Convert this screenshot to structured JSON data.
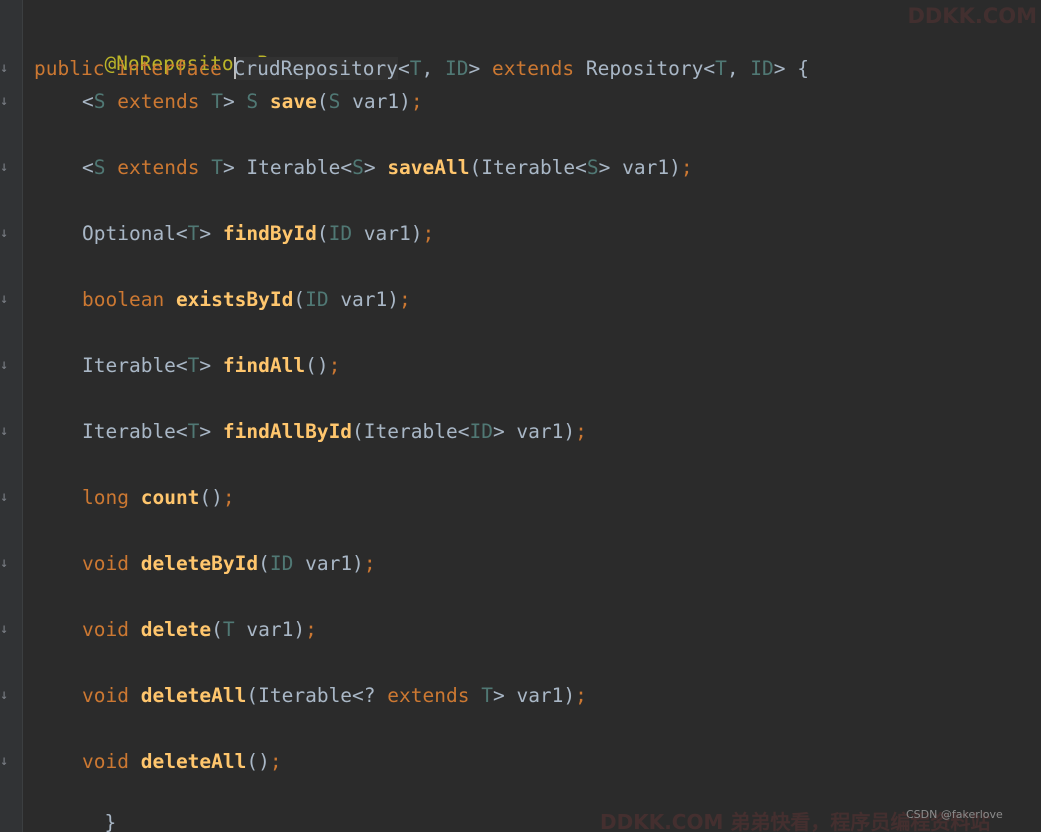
{
  "editor": {
    "code": {
      "annotation": "@NoRepositoryBean",
      "decl": {
        "public": "public",
        "interface": "interface",
        "name_first": "C",
        "name_rest": "rudRepository",
        "lt1": "<",
        "T": "T",
        "comma": ", ",
        "ID": "ID",
        "gt1": ">",
        "extends": "extends",
        "parent": "Repository",
        "lt2": "<",
        "T2": "T",
        "comma2": ", ",
        "ID2": "ID",
        "gt2": ">",
        "brace": "{"
      },
      "methods": [
        [
          {
            "t": "pl",
            "v": "<"
          },
          {
            "t": "tp",
            "v": "S"
          },
          {
            "t": "pl",
            "v": " "
          },
          {
            "t": "kw",
            "v": "extends"
          },
          {
            "t": "pl",
            "v": " "
          },
          {
            "t": "tp",
            "v": "T"
          },
          {
            "t": "pl",
            "v": "> "
          },
          {
            "t": "tp",
            "v": "S"
          },
          {
            "t": "pl",
            "v": " "
          },
          {
            "t": "fn",
            "v": "save"
          },
          {
            "t": "pl",
            "v": "("
          },
          {
            "t": "tp",
            "v": "S"
          },
          {
            "t": "pl",
            "v": " var1)"
          },
          {
            "t": "kw",
            "v": ";"
          }
        ],
        [
          {
            "t": "pl",
            "v": "<"
          },
          {
            "t": "tp",
            "v": "S"
          },
          {
            "t": "pl",
            "v": " "
          },
          {
            "t": "kw",
            "v": "extends"
          },
          {
            "t": "pl",
            "v": " "
          },
          {
            "t": "tp",
            "v": "T"
          },
          {
            "t": "pl",
            "v": "> Iterable<"
          },
          {
            "t": "tp",
            "v": "S"
          },
          {
            "t": "pl",
            "v": "> "
          },
          {
            "t": "fn",
            "v": "saveAll"
          },
          {
            "t": "pl",
            "v": "(Iterable<"
          },
          {
            "t": "tp",
            "v": "S"
          },
          {
            "t": "pl",
            "v": "> var1)"
          },
          {
            "t": "kw",
            "v": ";"
          }
        ],
        [
          {
            "t": "pl",
            "v": "Optional<"
          },
          {
            "t": "tp",
            "v": "T"
          },
          {
            "t": "pl",
            "v": "> "
          },
          {
            "t": "fn",
            "v": "findById"
          },
          {
            "t": "pl",
            "v": "("
          },
          {
            "t": "tp",
            "v": "ID"
          },
          {
            "t": "pl",
            "v": " var1)"
          },
          {
            "t": "kw",
            "v": ";"
          }
        ],
        [
          {
            "t": "kw",
            "v": "boolean"
          },
          {
            "t": "pl",
            "v": " "
          },
          {
            "t": "fn",
            "v": "existsById"
          },
          {
            "t": "pl",
            "v": "("
          },
          {
            "t": "tp",
            "v": "ID"
          },
          {
            "t": "pl",
            "v": " var1)"
          },
          {
            "t": "kw",
            "v": ";"
          }
        ],
        [
          {
            "t": "pl",
            "v": "Iterable<"
          },
          {
            "t": "tp",
            "v": "T"
          },
          {
            "t": "pl",
            "v": "> "
          },
          {
            "t": "fn",
            "v": "findAll"
          },
          {
            "t": "pl",
            "v": "()"
          },
          {
            "t": "kw",
            "v": ";"
          }
        ],
        [
          {
            "t": "pl",
            "v": "Iterable<"
          },
          {
            "t": "tp",
            "v": "T"
          },
          {
            "t": "pl",
            "v": "> "
          },
          {
            "t": "fn",
            "v": "findAllById"
          },
          {
            "t": "pl",
            "v": "(Iterable<"
          },
          {
            "t": "tp",
            "v": "ID"
          },
          {
            "t": "pl",
            "v": "> var1)"
          },
          {
            "t": "kw",
            "v": ";"
          }
        ],
        [
          {
            "t": "kw",
            "v": "long"
          },
          {
            "t": "pl",
            "v": " "
          },
          {
            "t": "fn",
            "v": "count"
          },
          {
            "t": "pl",
            "v": "()"
          },
          {
            "t": "kw",
            "v": ";"
          }
        ],
        [
          {
            "t": "kw",
            "v": "void"
          },
          {
            "t": "pl",
            "v": " "
          },
          {
            "t": "fn",
            "v": "deleteById"
          },
          {
            "t": "pl",
            "v": "("
          },
          {
            "t": "tp",
            "v": "ID"
          },
          {
            "t": "pl",
            "v": " var1)"
          },
          {
            "t": "kw",
            "v": ";"
          }
        ],
        [
          {
            "t": "kw",
            "v": "void"
          },
          {
            "t": "pl",
            "v": " "
          },
          {
            "t": "fn",
            "v": "delete"
          },
          {
            "t": "pl",
            "v": "("
          },
          {
            "t": "tp",
            "v": "T"
          },
          {
            "t": "pl",
            "v": " var1)"
          },
          {
            "t": "kw",
            "v": ";"
          }
        ],
        [
          {
            "t": "kw",
            "v": "void"
          },
          {
            "t": "pl",
            "v": " "
          },
          {
            "t": "fn",
            "v": "deleteAll"
          },
          {
            "t": "pl",
            "v": "(Iterable<? "
          },
          {
            "t": "kw",
            "v": "extends"
          },
          {
            "t": "pl",
            "v": " "
          },
          {
            "t": "tp",
            "v": "T"
          },
          {
            "t": "pl",
            "v": "> var1)"
          },
          {
            "t": "kw",
            "v": ";"
          }
        ],
        [
          {
            "t": "kw",
            "v": "void"
          },
          {
            "t": "pl",
            "v": " "
          },
          {
            "t": "fn",
            "v": "deleteAll"
          },
          {
            "t": "pl",
            "v": "()"
          },
          {
            "t": "kw",
            "v": ";"
          }
        ]
      ],
      "closing": "}"
    },
    "colors": {
      "background": "#2b2b2b",
      "keyword": "#cc7832",
      "annotation": "#bbb529",
      "type_param": "#507874",
      "method": "#ffc66d",
      "plain": "#a9b7c6"
    },
    "gutter_marker": "↓"
  },
  "watermarks": {
    "top": "DDKK.COM",
    "bottom": "DDKK.COM 弟弟快看，程序员编程资料站",
    "credit": "CSDN @fakerlove"
  }
}
